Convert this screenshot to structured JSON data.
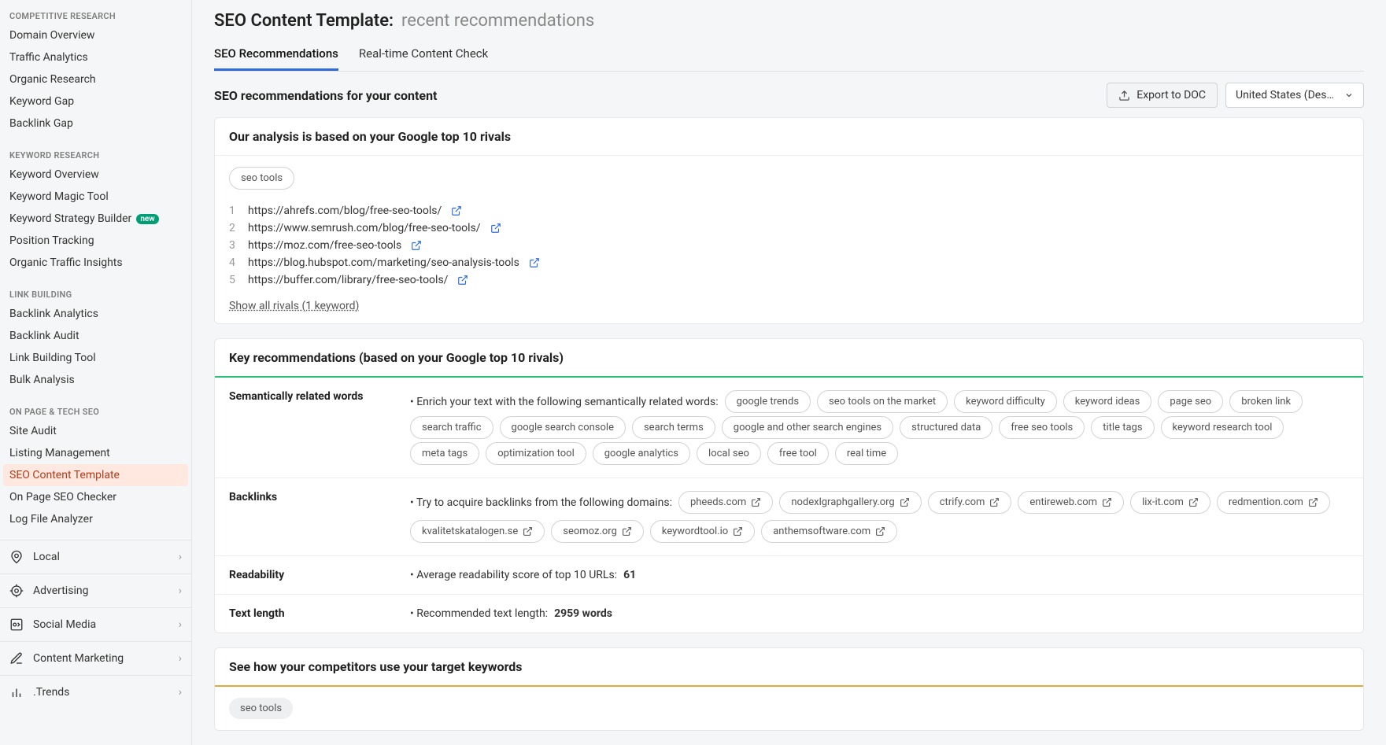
{
  "sidebar": {
    "section1": {
      "title": "COMPETITIVE RESEARCH",
      "items": [
        "Domain Overview",
        "Traffic Analytics",
        "Organic Research",
        "Keyword Gap",
        "Backlink Gap"
      ]
    },
    "section2": {
      "title": "KEYWORD RESEARCH",
      "items": [
        "Keyword Overview",
        "Keyword Magic Tool"
      ],
      "item_builder": "Keyword Strategy Builder",
      "badge_new": "new",
      "items2": [
        "Position Tracking",
        "Organic Traffic Insights"
      ]
    },
    "section3": {
      "title": "LINK BUILDING",
      "items": [
        "Backlink Analytics",
        "Backlink Audit",
        "Link Building Tool",
        "Bulk Analysis"
      ]
    },
    "section4": {
      "title": "ON PAGE & TECH SEO",
      "items": [
        "Site Audit",
        "Listing Management"
      ],
      "active": "SEO Content Template",
      "items2": [
        "On Page SEO Checker",
        "Log File Analyzer"
      ]
    },
    "footer": [
      "Local",
      "Advertising",
      "Social Media",
      "Content Marketing",
      ".Trends"
    ]
  },
  "header": {
    "title_prefix": "SEO Content Template:",
    "title_suffix": "recent recommendations",
    "tabs": [
      "SEO Recommendations",
      "Real-time Content Check"
    ]
  },
  "bar": {
    "heading": "SEO recommendations for your content",
    "export_label": "Export to DOC",
    "dropdown_label": "United States (Deskt…"
  },
  "analysis": {
    "title": "Our analysis is based on your Google top 10 rivals",
    "keyword": "seo tools",
    "rivals": [
      "https://ahrefs.com/blog/free-seo-tools/",
      "https://www.semrush.com/blog/free-seo-tools/",
      "https://moz.com/free-seo-tools",
      "https://blog.hubspot.com/marketing/seo-analysis-tools",
      "https://buffer.com/library/free-seo-tools/"
    ],
    "show_all": "Show all rivals (1 keyword)"
  },
  "key": {
    "title": "Key recommendations (based on your Google top 10 rivals)",
    "semantic": {
      "label": "Semantically related words",
      "lead": "Enrich your text with the following semantically related words:",
      "tags": [
        "google trends",
        "seo tools on the market",
        "keyword difficulty",
        "keyword ideas",
        "page seo",
        "broken link",
        "search traffic",
        "google search console",
        "search terms",
        "google and other search engines",
        "structured data",
        "free seo tools",
        "title tags",
        "keyword research tool",
        "meta tags",
        "optimization tool",
        "google analytics",
        "local seo",
        "free tool",
        "real time"
      ]
    },
    "backlinks": {
      "label": "Backlinks",
      "lead": "Try to acquire backlinks from the following domains:",
      "domains": [
        "pheeds.com",
        "nodexlgraphgallery.org",
        "ctrify.com",
        "entireweb.com",
        "lix-it.com",
        "redmention.com",
        "kvalitetskatalogen.se",
        "seomoz.org",
        "keywordtool.io",
        "anthemsoftware.com"
      ]
    },
    "readability": {
      "label": "Readability",
      "lead": "Average readability score of top 10 URLs:",
      "value": "61"
    },
    "textlength": {
      "label": "Text length",
      "lead": "Recommended text length:",
      "value": "2959 words"
    }
  },
  "competitor": {
    "title": "See how your competitors use your target keywords",
    "keyword": "seo tools"
  }
}
